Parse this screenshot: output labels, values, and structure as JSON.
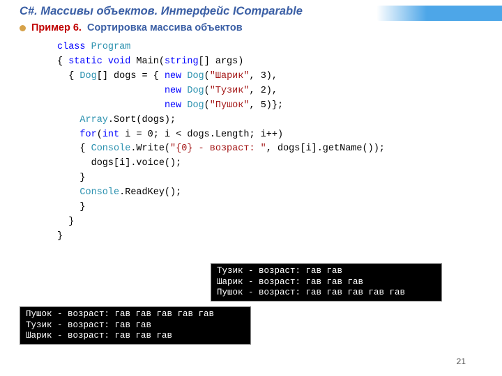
{
  "header": {
    "title": "C#. Массивы объектов. Интерфейс IComparable",
    "example_label": "Пример 6.",
    "example_text": "Сортировка массива объектов"
  },
  "code": {
    "l01a": "class",
    "l01b": " ",
    "l01c": "Program",
    "l02a": "{ ",
    "l02b": "static",
    "l02c": " ",
    "l02d": "void",
    "l02e": " Main(",
    "l02f": "string",
    "l02g": "[] args)",
    "l03a": "  { ",
    "l03b": "Dog",
    "l03c": "[] dogs = { ",
    "l03d": "new",
    "l03e": " ",
    "l03f": "Dog",
    "l03g": "(",
    "l03h": "\"Шарик\"",
    "l03i": ", 3),",
    "l04a": "                   ",
    "l04b": "new",
    "l04c": " ",
    "l04d": "Dog",
    "l04e": "(",
    "l04f": "\"Тузик\"",
    "l04g": ", 2),",
    "l05a": "                   ",
    "l05b": "new",
    "l05c": " ",
    "l05d": "Dog",
    "l05e": "(",
    "l05f": "\"Пушок\"",
    "l05g": ", 5)};",
    "l06a": "    ",
    "l06b": "Array",
    "l06c": ".Sort(dogs);",
    "l07a": "    ",
    "l07b": "for",
    "l07c": "(",
    "l07d": "int",
    "l07e": " i = 0; i < dogs.Length; i++)",
    "l08a": "    { ",
    "l08b": "Console",
    "l08c": ".Write(",
    "l08d": "\"{0} - возраст: \"",
    "l08e": ", dogs[i].getName());",
    "l09": "      dogs[i].voice();",
    "l10": "    }",
    "l11a": "    ",
    "l11b": "Console",
    "l11c": ".ReadKey();",
    "l12": "    }",
    "l13": "  }",
    "l14": "}"
  },
  "output1": "Тузик - возраст: гав гав\nШарик - возраст: гав гав гав\nПушок - возраст: гав гав гав гав гав",
  "output2": "Пушок - возраст: гав гав гав гав гав\nТузик - возраст: гав гав\nШарик - возраст: гав гав гав",
  "page_number": "21"
}
